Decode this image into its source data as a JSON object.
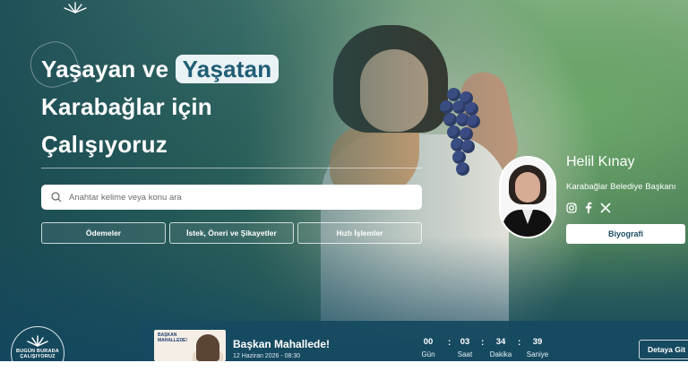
{
  "hero": {
    "headline_part1": "Yaşayan ve",
    "headline_highlight": "Yaşatan",
    "headline_line2": "Karabağlar için",
    "headline_line3": "Çalışıyoruz"
  },
  "search": {
    "placeholder": "Anahtar kelime veya konu ara"
  },
  "quick_buttons": [
    {
      "label": "Ödemeler"
    },
    {
      "label": "İstek, Öneri ve Şikayetler"
    },
    {
      "label": "Hızlı İşlemler"
    }
  ],
  "mayor": {
    "name": "Helil Kınay",
    "title": "Karabağlar Belediye Başkanı",
    "bio_button": "Biyografi"
  },
  "event": {
    "thumbnail_text": "BAŞKAN MAHALLEDE!",
    "title": "Başkan Mahallede!",
    "date": "12 Haziran 2026 - 08:30",
    "countdown": [
      {
        "value": "00",
        "label": "Gün"
      },
      {
        "value": "03",
        "label": "Saat"
      },
      {
        "value": "34",
        "label": "Dakika"
      },
      {
        "value": "39",
        "label": "Saniye"
      }
    ],
    "detail_button": "Detaya Git"
  },
  "badge": {
    "line1": "BUGÜN BURADA",
    "line2": "ÇALIŞIYORUZ"
  },
  "icons": {
    "search": "search-icon",
    "instagram": "instagram-icon",
    "facebook": "facebook-icon",
    "x": "x-icon",
    "logo": "municipality-logo-icon"
  }
}
